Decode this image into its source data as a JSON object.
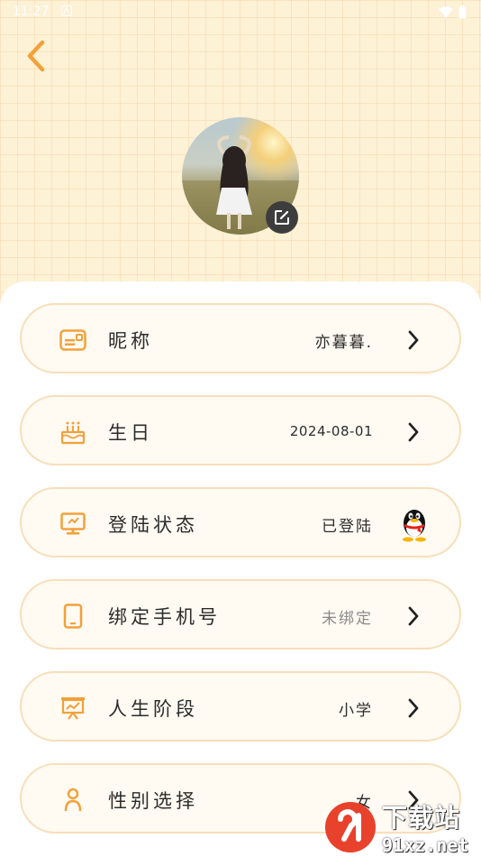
{
  "status_bar": {
    "time": "11:27"
  },
  "colors": {
    "accent": "#f2a13a",
    "row_border": "#f6dfb9",
    "background": "#fdf1d6"
  },
  "rows": [
    {
      "label": "昵称",
      "value": "亦暮暮.",
      "icon": "id-card-icon",
      "trailing": "chevron"
    },
    {
      "label": "生日",
      "value": "2024-08-01",
      "icon": "cake-icon",
      "trailing": "chevron"
    },
    {
      "label": "登陆状态",
      "value": "已登陆",
      "icon": "monitor-icon",
      "trailing": "qq-logo"
    },
    {
      "label": "绑定手机号",
      "value": "未绑定",
      "icon": "phone-icon",
      "trailing": "chevron"
    },
    {
      "label": "人生阶段",
      "value": "小学",
      "icon": "presentation-icon",
      "trailing": "chevron"
    },
    {
      "label": "性别选择",
      "value": "女",
      "icon": "person-icon",
      "trailing": "chevron"
    }
  ],
  "watermark": {
    "top": "下载站",
    "bottom": "91xz.net"
  }
}
